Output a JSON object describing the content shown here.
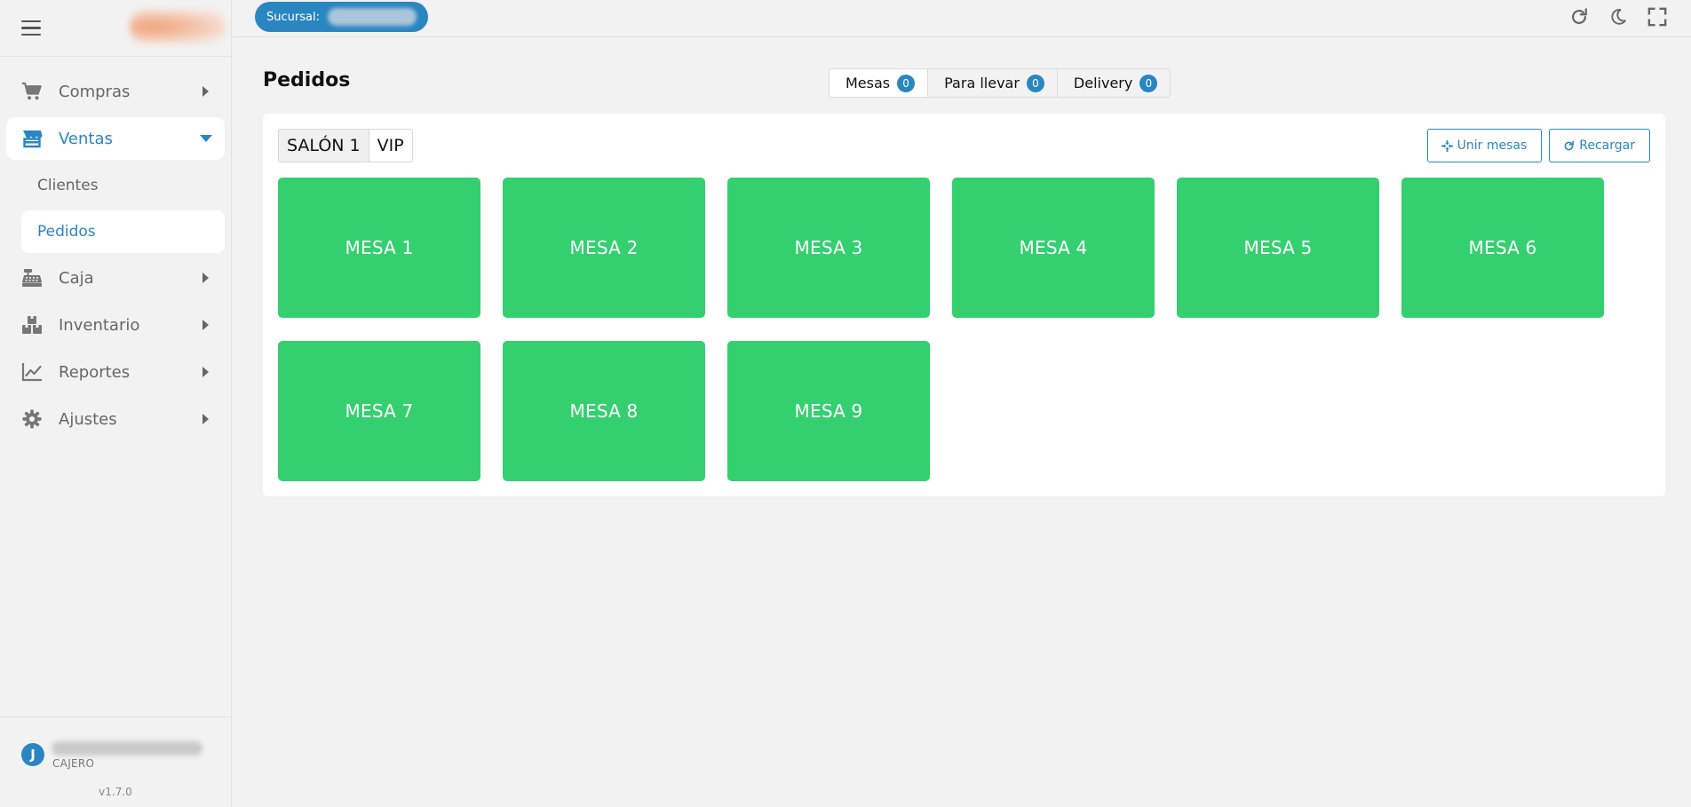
{
  "sidebar": {
    "items": [
      {
        "label": "Compras",
        "icon": "cart-icon"
      },
      {
        "label": "Ventas",
        "icon": "store-icon"
      },
      {
        "label": "Caja",
        "icon": "cash-register-icon"
      },
      {
        "label": "Inventario",
        "icon": "boxes-icon"
      },
      {
        "label": "Reportes",
        "icon": "chart-line-icon"
      },
      {
        "label": "Ajustes",
        "icon": "gear-icon"
      }
    ],
    "ventas_sub": [
      {
        "label": "Clientes"
      },
      {
        "label": "Pedidos"
      }
    ],
    "user": {
      "initial": "J",
      "role": "CAJERO"
    },
    "version": "v1.7.0"
  },
  "topbar": {
    "branch_label": "Sucursal:",
    "icons": [
      "reload-icon",
      "moon-icon",
      "fullscreen-icon"
    ]
  },
  "main": {
    "title": "Pedidos",
    "tabs": [
      {
        "label": "Mesas",
        "count": "0"
      },
      {
        "label": "Para llevar",
        "count": "0"
      },
      {
        "label": "Delivery",
        "count": "0"
      }
    ],
    "rooms": [
      {
        "label": "SALÓN 1"
      },
      {
        "label": "VIP"
      }
    ],
    "actions": {
      "join": "Unir mesas",
      "reload": "Recargar"
    },
    "tables": [
      "MESA 1",
      "MESA 2",
      "MESA 3",
      "MESA 4",
      "MESA 5",
      "MESA 6",
      "MESA 7",
      "MESA 8",
      "MESA 9"
    ]
  },
  "colors": {
    "accent": "#2a86c1",
    "table_available": "#34d070",
    "background": "#f2f2f2"
  }
}
